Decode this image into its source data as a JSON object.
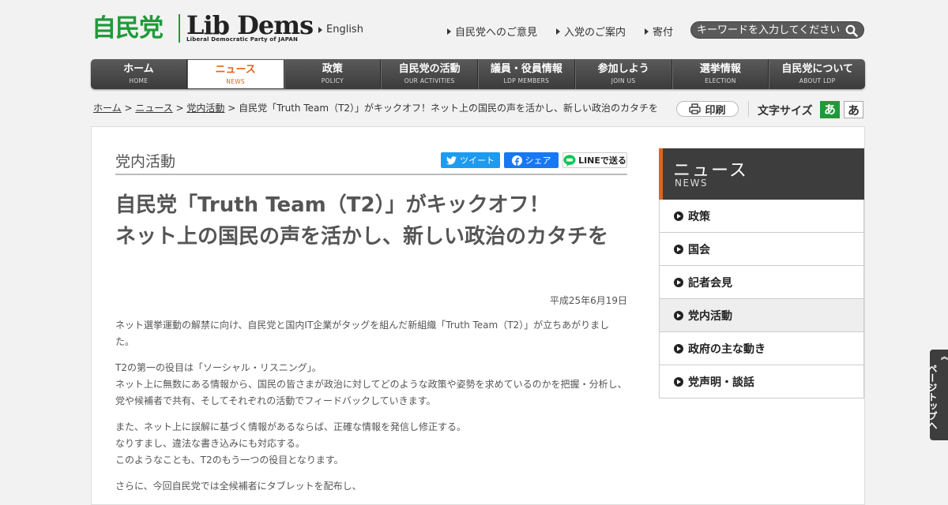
{
  "header": {
    "logo_jp": "自民党",
    "logo_en": "Lib Dems",
    "logo_en_sub": "Liberal Democratic Party of JAPAN",
    "english_link": "English",
    "links": [
      "自民党へのご意見",
      "入党のご案内",
      "寄付"
    ],
    "search_placeholder": "キーワードを入力してください"
  },
  "nav": [
    {
      "jp": "ホーム",
      "en": "HOME"
    },
    {
      "jp": "ニュース",
      "en": "NEWS",
      "active": true
    },
    {
      "jp": "政策",
      "en": "POLICY"
    },
    {
      "jp": "自民党の活動",
      "en": "OUR ACTIVITIES"
    },
    {
      "jp": "議員・役員情報",
      "en": "LDP MEMBERS"
    },
    {
      "jp": "参加しよう",
      "en": "JOIN US"
    },
    {
      "jp": "選挙情報",
      "en": "ELECTION"
    },
    {
      "jp": "自民党について",
      "en": "ABOUT LDP"
    }
  ],
  "breadcrumb": {
    "home": "ホーム",
    "news": "ニュース",
    "category": "党内活動",
    "current": "自民党「Truth Team（T2）」がキックオフ！ネット上の国民の声を活かし、新しい政治のカタチを",
    "sep": " > "
  },
  "tools": {
    "print": "印刷",
    "font_size_label": "文字サイズ",
    "font_small": "あ",
    "font_large": "あ"
  },
  "article": {
    "category": "党内活動",
    "share_twitter": "ツイート",
    "share_facebook": "シェア",
    "share_line": "LINEで送る",
    "title_line1": "自民党「Truth Team（T2）」がキックオフ！",
    "title_line2": "ネット上の国民の声を活かし、新しい政治のカタチを",
    "date": "平成25年6月19日",
    "p1": "ネット選挙運動の解禁に向け、自民党と国内IT企業がタッグを組んだ新組織「Truth Team（T2）」が立ちあがりました。",
    "p2a": "T2の第一の役目は「ソーシャル・リスニング」。",
    "p2b": "ネット上に無数にある情報から、国民の皆さまが政治に対してどのような政策や姿勢を求めているのかを把握・分析し、党や候補者で共有、そしてそれぞれの活動でフィードバックしていきます。",
    "p3a": "また、ネット上に誤解に基づく情報があるならば、正確な情報を発信し修正する。",
    "p3b": "なりすまし、違法な書き込みにも対応する。",
    "p3c": "このようなことも、T2のもう一つの役目となります。",
    "p4a": "さらに、今回自民党では全候補者にタブレットを配布し、"
  },
  "sidebar": {
    "head_jp": "ニュース",
    "head_en": "NEWS",
    "items": [
      "政策",
      "国会",
      "記者会見",
      "党内活動",
      "政府の主な動き",
      "党声明・談話"
    ],
    "active_index": 3
  },
  "pagetop": "ページトップへ",
  "colors": {
    "brand_green": "#1f9a3a",
    "accent_orange": "#e0641a",
    "nav_dark": "#3d3d3d"
  }
}
